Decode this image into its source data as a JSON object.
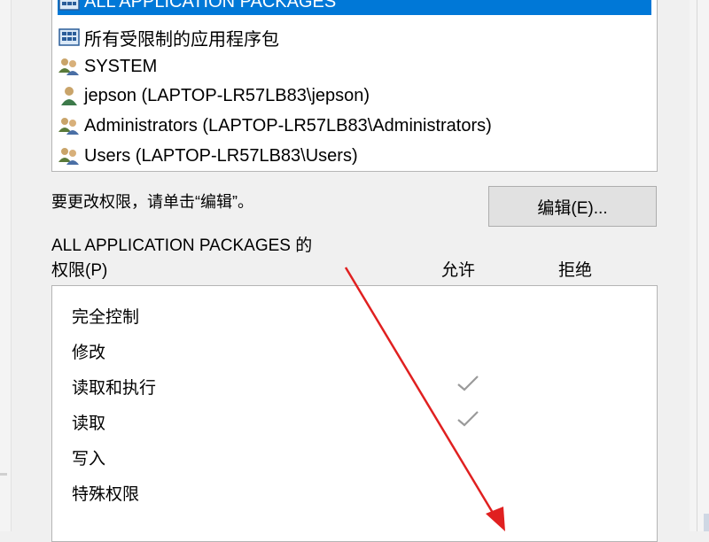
{
  "users": [
    {
      "label": "ALL APPLICATION PACKAGES",
      "icon": "app-package-icon",
      "selected": true
    },
    {
      "label": "所有受限制的应用程序包",
      "icon": "app-package-icon",
      "selected": false
    },
    {
      "label": "SYSTEM",
      "icon": "user-group-icon",
      "selected": false
    },
    {
      "label": "jepson (LAPTOP-LR57LB83\\jepson)",
      "icon": "user-icon",
      "selected": false
    },
    {
      "label": "Administrators (LAPTOP-LR57LB83\\Administrators)",
      "icon": "user-group-icon",
      "selected": false
    },
    {
      "label": "Users (LAPTOP-LR57LB83\\Users)",
      "icon": "user-group-icon",
      "selected": false
    }
  ],
  "hint": "要更改权限，请单击“编辑”。",
  "edit_button": "编辑(E)...",
  "permissions_title_line1": "ALL APPLICATION PACKAGES 的",
  "permissions_title_line2": "权限(P)",
  "columns": {
    "allow": "允许",
    "deny": "拒绝"
  },
  "permissions": [
    {
      "label": "完全控制",
      "allow": false,
      "deny": false
    },
    {
      "label": "修改",
      "allow": false,
      "deny": false
    },
    {
      "label": "读取和执行",
      "allow": true,
      "deny": false
    },
    {
      "label": "读取",
      "allow": true,
      "deny": false
    },
    {
      "label": "写入",
      "allow": false,
      "deny": false
    },
    {
      "label": "特殊权限",
      "allow": false,
      "deny": false
    }
  ],
  "colors": {
    "selection": "#0078d7",
    "annotation_arrow": "#e02020",
    "checkmark": "#9a9a9a"
  }
}
